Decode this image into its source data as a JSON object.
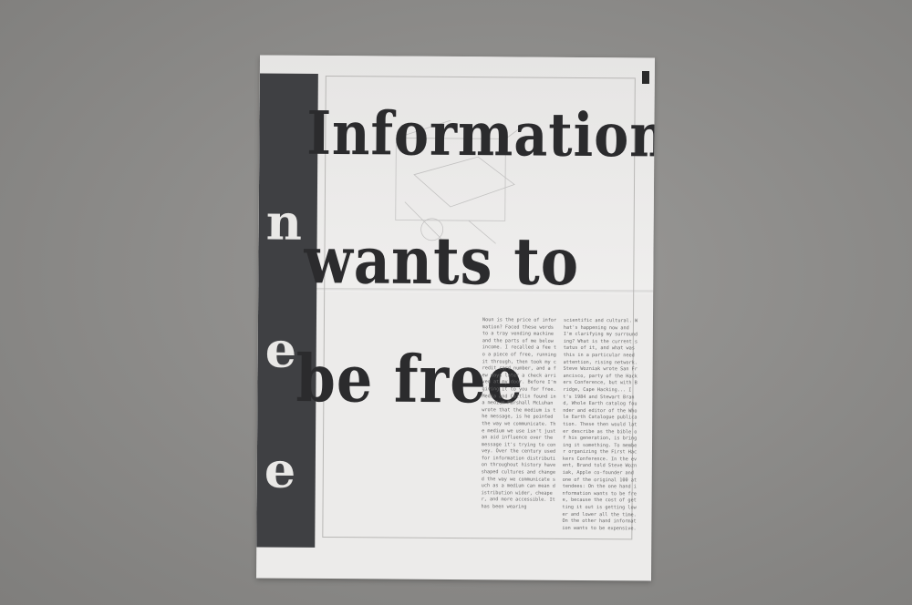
{
  "scene": {
    "background_color": "#8d8c8a",
    "paper_color": "#ecebea",
    "band_color": "#3f4043",
    "ink_color": "#2b2b2d"
  },
  "poster": {
    "headline_lines": [
      "Information",
      "wants to",
      "be free"
    ],
    "left_fragments": [
      "n",
      "e",
      "e"
    ],
    "column_1": "Noun is the price of information? Faced these words to a tray vending machine and the parts of me below income. I recalled a fee to a piece of free, running it through, then took my credit card number, and a few days later a check arrived at my door. Before I'm giving it to you for free. Media and Caltlin found in a medium Marshall McLuhan wrote that the medium is the message, is he pointed the way we communicate. The medium we use isn't just an aid influence over the message it's trying to convey. Over the century used for information distribution throughout history have shaped cultures and changed the way we communicate such as a medium can mean distribution wider, cheaper, and more accessible. It has been wearing",
    "column_2": "scientific and cultural. What's happening now and I'm clarifying my surrounding? What is the current status of it, and what was this in a particular need attention, rising network. Steve Wozniak wrote San Francisco, party of the Hackers Conference, but with Bridge, Cape Hacking... It's 1984 and Stewart Brand, Whole Earth catalog founder and editor of the Whole Earth Catalogue publication. These then would later describe as the bible of his generation, is bringing it something. To member organizing the First Hackers Conference. In the event, Brand told Steve Wozniak, Apple co-founder and one of the original 100 attendees: On the one hand information wants to be free, because the cost of getting it out is getting lower and lower all the time. On the other hand information wants to be expensive."
  }
}
